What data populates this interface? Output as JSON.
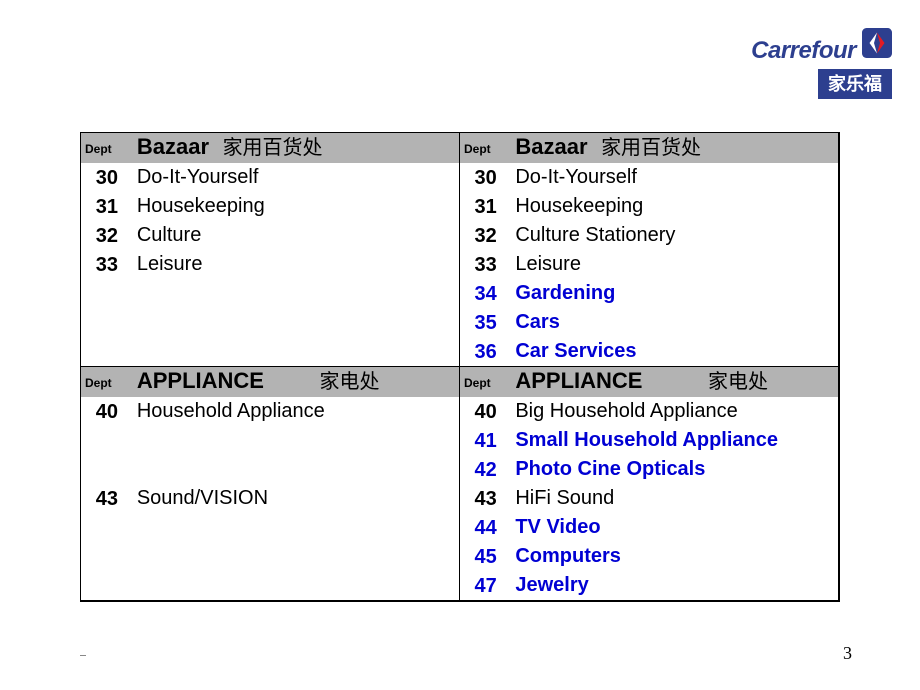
{
  "brand": {
    "name": "Carrefour",
    "sub_cn": "家乐福"
  },
  "page_number": "3",
  "headers": {
    "dept_label": "Dept",
    "bazaar_en": "Bazaar",
    "bazaar_cn": "家用百货处",
    "appliance_en": "APPLIANCE",
    "appliance_cn": "家电处"
  },
  "left_bazaar": [
    {
      "num": "30",
      "name": "Do-It-Yourself"
    },
    {
      "num": "31",
      "name": "Housekeeping"
    },
    {
      "num": "32",
      "name": "Culture"
    },
    {
      "num": "33",
      "name": "Leisure"
    }
  ],
  "right_bazaar": [
    {
      "num": "30",
      "name": "Do-It-Yourself",
      "hl": false
    },
    {
      "num": "31",
      "name": "Housekeeping",
      "hl": false
    },
    {
      "num": "32",
      "name": "Culture Stationery",
      "hl": false
    },
    {
      "num": "33",
      "name": "Leisure",
      "hl": false
    },
    {
      "num": "34",
      "name": "Gardening",
      "hl": true
    },
    {
      "num": "35",
      "name": "Cars",
      "hl": true
    },
    {
      "num": "36",
      "name": "Car Services",
      "hl": true
    }
  ],
  "left_appliance": [
    {
      "num": "40",
      "name": "Household Appliance"
    },
    {
      "num": "",
      "name": ""
    },
    {
      "num": "",
      "name": ""
    },
    {
      "num": "43",
      "name": "Sound/VISION"
    }
  ],
  "right_appliance": [
    {
      "num": "40",
      "name": "Big Household Appliance",
      "hl": false
    },
    {
      "num": "41",
      "name": "Small Household Appliance",
      "hl": true
    },
    {
      "num": "42",
      "name": "Photo Cine Opticals",
      "hl": true
    },
    {
      "num": "43",
      "name": "HiFi Sound",
      "hl": false
    },
    {
      "num": "44",
      "name": "TV Video",
      "hl": true
    },
    {
      "num": "45",
      "name": "Computers",
      "hl": true
    },
    {
      "num": "47",
      "name": "Jewelry",
      "hl": true
    }
  ]
}
